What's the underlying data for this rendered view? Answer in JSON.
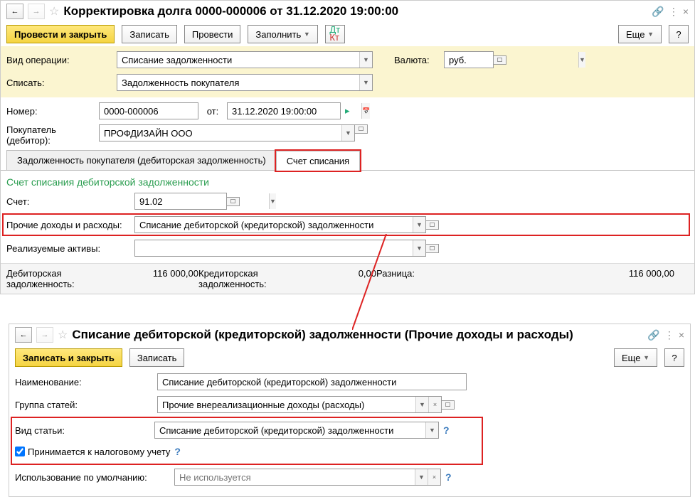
{
  "win1": {
    "title": "Корректировка долга 0000-000006 от 31.12.2020 19:00:00",
    "toolbar": {
      "post_close": "Провести и закрыть",
      "save": "Записать",
      "post": "Провести",
      "fill": "Заполнить",
      "more": "Еще",
      "help": "?"
    },
    "op_type_label": "Вид операции:",
    "op_type_value": "Списание задолженности",
    "currency_label": "Валюта:",
    "currency_value": "руб.",
    "writeoff_label": "Списать:",
    "writeoff_value": "Задолженность покупателя",
    "number_label": "Номер:",
    "number_value": "0000-000006",
    "from_label": "от:",
    "date_value": "31.12.2020 19:00:00",
    "buyer_label": "Покупатель (дебитор):",
    "buyer_value": "ПРОФДИЗАЙН ООО",
    "tabs": {
      "tab1": "Задолженность покупателя (дебиторская задолженность)",
      "tab2": "Счет списания"
    },
    "section": "Счет списания дебиторской задолженности",
    "account_label": "Счет:",
    "account_value": "91.02",
    "other_label": "Прочие доходы и расходы:",
    "other_value": "Списание дебиторской (кредиторской) задолженности",
    "assets_label": "Реализуемые активы:",
    "totals": {
      "debit_label": "Дебиторская задолженность:",
      "debit_value": "116 000,00",
      "credit_label": "Кредиторская задолженность:",
      "credit_value": "0,00",
      "diff_label": "Разница:",
      "diff_value": "116 000,00"
    }
  },
  "win2": {
    "title": "Списание дебиторской (кредиторской) задолженности (Прочие доходы и расходы)",
    "toolbar": {
      "save_close": "Записать и закрыть",
      "save": "Записать",
      "more": "Еще",
      "help": "?"
    },
    "name_label": "Наименование:",
    "name_value": "Списание дебиторской (кредиторской) задолженности",
    "group_label": "Группа статей:",
    "group_value": "Прочие внереализационные доходы (расходы)",
    "kind_label": "Вид статьи:",
    "kind_value": "Списание дебиторской (кредиторской) задолженности",
    "tax_checkbox": "Принимается к налоговому учету",
    "default_label": "Использование по умолчанию:",
    "default_placeholder": "Не используется"
  }
}
